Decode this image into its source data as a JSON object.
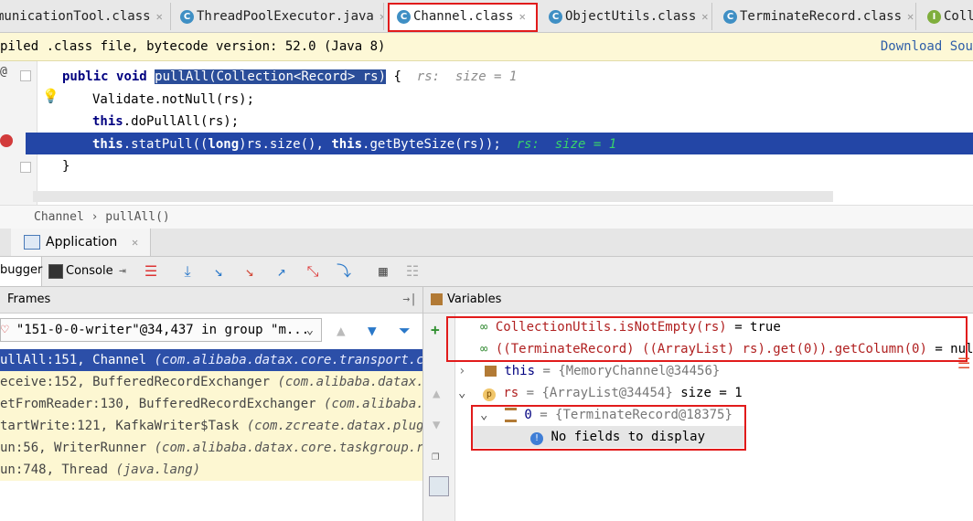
{
  "tabs": [
    {
      "label": "municationTool.class",
      "icon": "class-icon",
      "active": false
    },
    {
      "label": "ThreadPoolExecutor.java",
      "icon": "class-icon",
      "active": false
    },
    {
      "label": "Channel.class",
      "icon": "class-icon",
      "active": true
    },
    {
      "label": "ObjectUtils.class",
      "icon": "class-icon",
      "active": false
    },
    {
      "label": "TerminateRecord.class",
      "icon": "class-icon",
      "active": false
    },
    {
      "label": "Coll",
      "icon": "interface-icon",
      "active": false
    }
  ],
  "tab_close": "✕",
  "banner": {
    "text": "piled .class file, bytecode version: 52.0 (Java 8)",
    "download_link": "Download Sou"
  },
  "code": {
    "line1": {
      "kw1": "public",
      "kw2": "void",
      "selected": "pullAll(Collection<Record> rs)",
      "tail": " {",
      "hint": "rs:  size = 1"
    },
    "line2": "Validate.notNull(rs);",
    "line3": {
      "kw": "this",
      "rest": ".doPullAll(rs);"
    },
    "line4": {
      "kw1": "this",
      "a": ".statPull((",
      "kw2": "long",
      "b": ")rs.size(), ",
      "kw3": "this",
      "c": ".getByteSize(rs));",
      "hint": "rs:  size = 1"
    },
    "line5": "}"
  },
  "breadcrumbs": [
    "Channel",
    "pullAll()"
  ],
  "breadcrumb_sep": "›",
  "debug": {
    "run_config": "Application",
    "tabs": {
      "debugger": "bugger",
      "console": "Console"
    },
    "frames_title": "Frames",
    "variables_title": "Variables",
    "thread": "\"151-0-0-writer\"@34,437 in group \"m...",
    "frames": [
      {
        "method": "ullAll:151, Channel",
        "pkg": "(com.alibaba.datax.core.transport.chan"
      },
      {
        "method": "eceive:152, BufferedRecordExchanger",
        "pkg": "(com.alibaba.datax.cor"
      },
      {
        "method": "etFromReader:130, BufferedRecordExchanger",
        "pkg": "(com.alibaba.dat"
      },
      {
        "method": "tartWrite:121, KafkaWriter$Task",
        "pkg": "(com.zcreate.datax.plugin."
      },
      {
        "method": "un:56, WriterRunner",
        "pkg": "(com.alibaba.datax.core.taskgroup.runr"
      },
      {
        "method": "un:748, Thread",
        "pkg": "(java.lang)"
      }
    ],
    "watches": [
      {
        "expr": "CollectionUtils.isNotEmpty(rs)",
        "value": "= true"
      },
      {
        "expr": "((TerminateRecord) ((ArrayList) rs).get(0)).getColumn(0)",
        "value": "= null"
      }
    ],
    "vars": {
      "this": {
        "name": "this",
        "value": "= {MemoryChannel@34456}"
      },
      "rs": {
        "name": "rs",
        "value": "= {ArrayList@34454}",
        "size": "size = 1"
      },
      "item0": {
        "name": "0",
        "value": "= {TerminateRecord@18375}"
      },
      "empty": "No fields to display"
    }
  },
  "colors": {
    "accent": "#2346a6",
    "highlight_box": "#e11b1b",
    "banner_bg": "#fdf8d6",
    "link": "#2f5ea8"
  }
}
